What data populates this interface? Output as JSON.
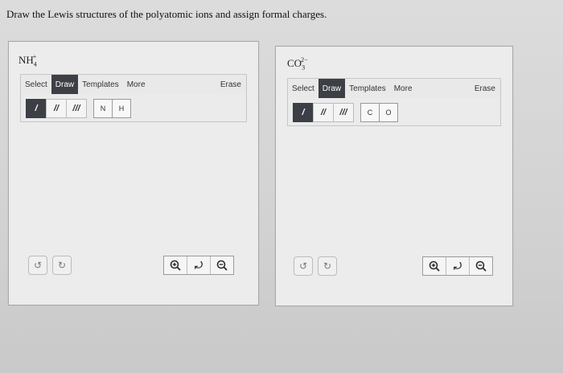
{
  "instruction": "Draw the Lewis structures of the polyatomic ions and assign formal charges.",
  "panels": [
    {
      "formula": {
        "base": "NH",
        "sub": "4",
        "sup": "+"
      },
      "toolbar": {
        "select": "Select",
        "draw": "Draw",
        "templates": "Templates",
        "more": "More",
        "erase": "Erase"
      },
      "bonds": [
        "/",
        "//",
        "///"
      ],
      "atoms": [
        "N",
        "H"
      ]
    },
    {
      "formula": {
        "base": "CO",
        "sub": "3",
        "sup": "2−"
      },
      "toolbar": {
        "select": "Select",
        "draw": "Draw",
        "templates": "Templates",
        "more": "More",
        "erase": "Erase"
      },
      "bonds": [
        "/",
        "//",
        "///"
      ],
      "atoms": [
        "C",
        "O"
      ]
    }
  ],
  "icons": {
    "undo": "undo-icon",
    "redo": "redo-icon",
    "zoom_in": "zoom-in-icon",
    "reset": "reset-zoom-icon",
    "zoom_out": "zoom-out-icon"
  }
}
